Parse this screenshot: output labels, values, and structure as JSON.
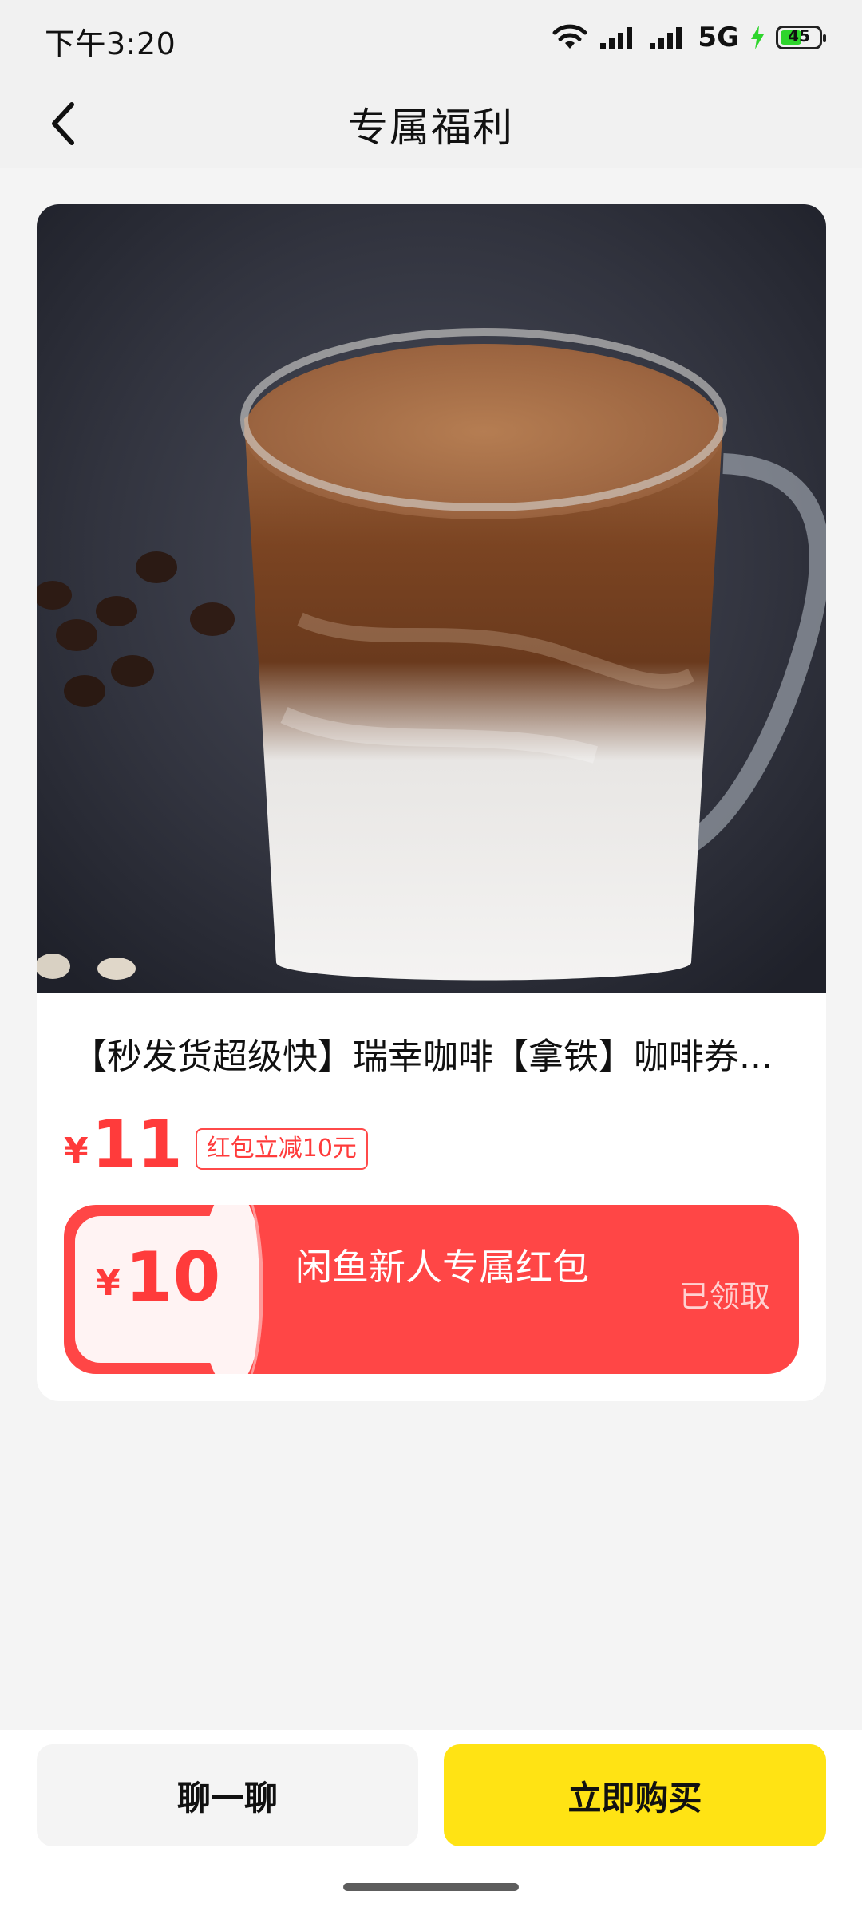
{
  "status": {
    "time": "下午3:20",
    "network": "5G",
    "battery": "45"
  },
  "header": {
    "title": "专属福利"
  },
  "product": {
    "title": "【秒发货超级快】瑞幸咖啡【拿铁】咖啡券...",
    "currency": "¥",
    "price": "11",
    "discount_badge": "红包立减10元"
  },
  "coupon": {
    "currency": "¥",
    "amount": "10",
    "title": "闲鱼新人专属红包",
    "status": "已领取"
  },
  "bottom": {
    "chat_label": "聊一聊",
    "buy_label": "立即购买"
  },
  "colors": {
    "accent_red": "#ff4646",
    "buy_yellow": "#ffe314"
  }
}
